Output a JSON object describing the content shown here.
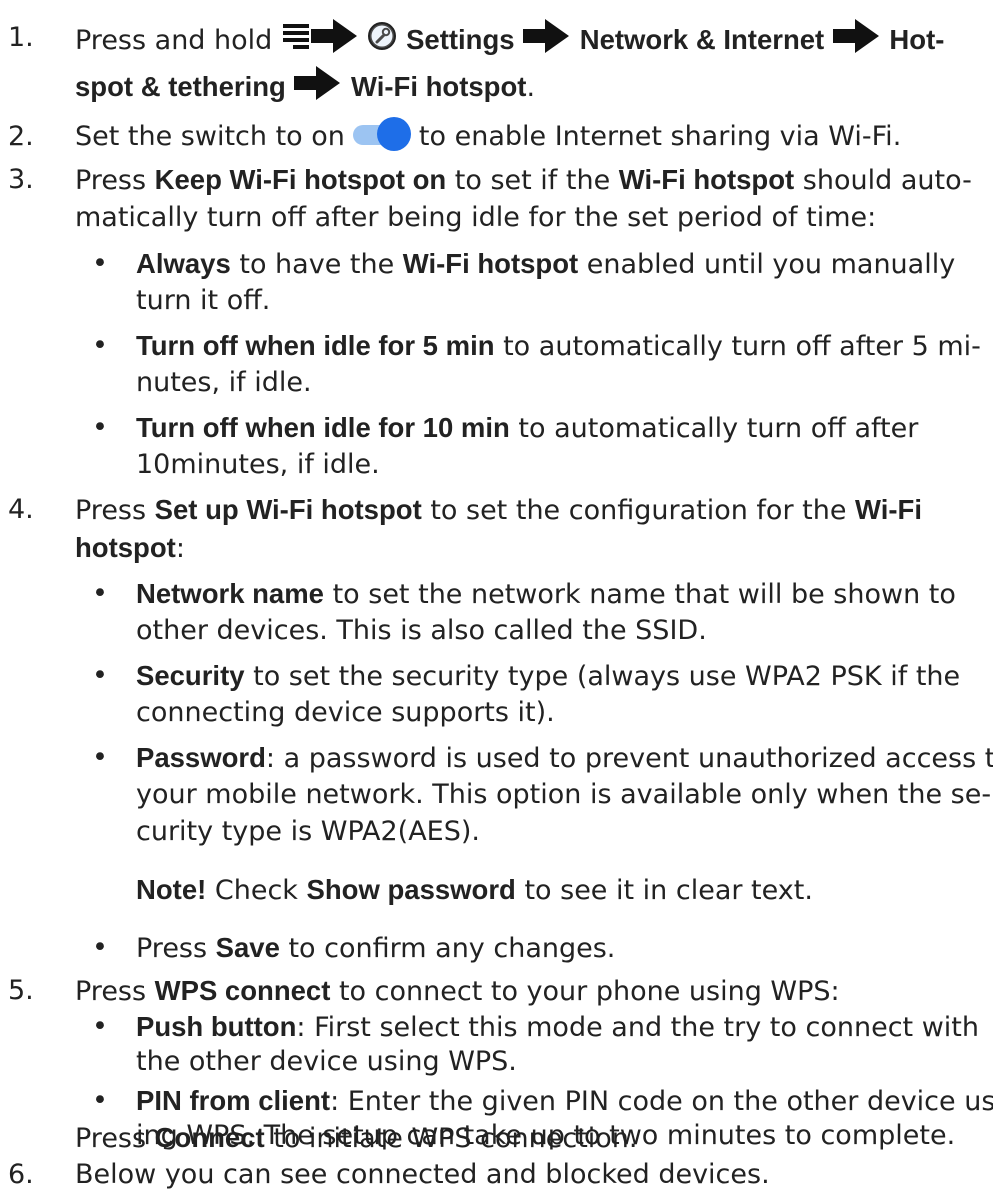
{
  "steps": {
    "s1": {
      "num": "1.",
      "press_hold": "Press and hold ",
      "settings": "Settings",
      "network": "Network & Internet",
      "hot": "Hot-",
      "spot": "spot & tethering",
      "wifi_hotspot": "Wi-Fi hotspot",
      "end": "."
    },
    "s2": {
      "num": "2.",
      "before": "Set the switch to on",
      "after": "to enable Internet sharing via Wi-Fi."
    },
    "s3": {
      "num": "3.",
      "press": "Press ",
      "keep": "Keep Wi-Fi hotspot on",
      "mid": " to set if the ",
      "hotspot": "Wi-Fi hotspot",
      "end1": " should auto-",
      "line2": "matically turn off after being idle for the set period of time:",
      "bullets": {
        "always": {
          "label": "Always",
          "t1": " to have the ",
          "hotspot": "Wi-Fi hotspot",
          "t2": " enabled until you manually",
          "line2": "turn it off."
        },
        "five": {
          "label": "Turn off when idle for 5 min",
          "t1": " to automatically turn off after 5 mi-",
          "line2": "nutes, if idle."
        },
        "ten": {
          "label": "Turn off when idle for 10 min",
          "t1": " to automatically turn off after",
          "line2": "10minutes, if idle."
        }
      }
    },
    "s4": {
      "num": "4.",
      "press": "Press ",
      "setup": "Set up Wi-Fi hotspot",
      "mid": " to set the configuration for the ",
      "wifi": "Wi-Fi",
      "hotspot": "hotspot",
      "colon": ":",
      "bullets": {
        "network": {
          "label": "Network name",
          "t1": " to set the network name that will be shown to",
          "line2": "other devices. This is also called the SSID."
        },
        "security": {
          "label": "Security",
          "t1": " to set the security type (always use WPA2 PSK if the",
          "line2": "connecting device supports it)."
        },
        "password": {
          "label": "Password",
          "t1": ": a password is used to prevent unauthorized access to",
          "line2": "your mobile network. This option is available only when the se-",
          "line3": "curity type is WPA2(AES)."
        },
        "note": {
          "label": "Note!",
          "t1": " Check ",
          "show": "Show password",
          "t2": " to see it in clear text."
        },
        "save": {
          "press": "Press ",
          "label": "Save",
          "t1": " to confirm any changes."
        }
      }
    },
    "s5": {
      "num": "5.",
      "press": "Press ",
      "wps": "WPS connect",
      "t1": " to connect to your phone using WPS:",
      "bullets": {
        "push": {
          "label": "Push button",
          "t1": ": First select this mode and the try to connect with",
          "line2": "the other device using WPS."
        },
        "pin": {
          "label": "PIN from client",
          "t1": ": Enter the given PIN code on the other device us-",
          "line2": "ing WPS. The setup can take up to two minutes to complete."
        }
      },
      "connect_press": "Press ",
      "connect": "Connect",
      "connect_t": " to initiate WPS connection."
    },
    "s6": {
      "num": "6.",
      "text": "Below you can see connected and blocked devices."
    }
  },
  "bullet_char": "•",
  "icons": [
    "menu-icon",
    "arrow-right-icon",
    "settings-wrench-icon",
    "toggle-switch-icon"
  ],
  "colors": {
    "text": "#222222",
    "toggle_track": "#9cc4f2",
    "toggle_knob": "#1e6ee8"
  }
}
